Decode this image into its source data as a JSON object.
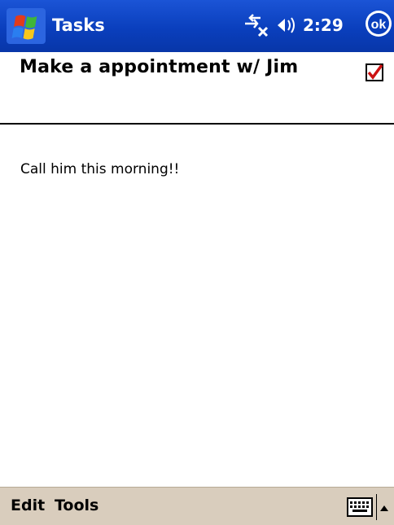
{
  "titlebar": {
    "app_title": "Tasks",
    "clock": "2:29",
    "ok_label": "ok",
    "start_icon": "windows-flag-icon",
    "connectivity_icon": "connectivity-icon",
    "volume_icon": "volume-icon",
    "colors": {
      "bar": "#0a3fbd",
      "text": "#ffffff"
    }
  },
  "task": {
    "subject": "Make a appointment w/ Jim",
    "completed": true,
    "note": "Call him this morning!!"
  },
  "menubar": {
    "edit_label": "Edit",
    "tools_label": "Tools",
    "keyboard_icon": "keyboard-icon",
    "arrow_icon": "arrow-up-icon",
    "colors": {
      "bar": "#d9cdbd"
    }
  }
}
